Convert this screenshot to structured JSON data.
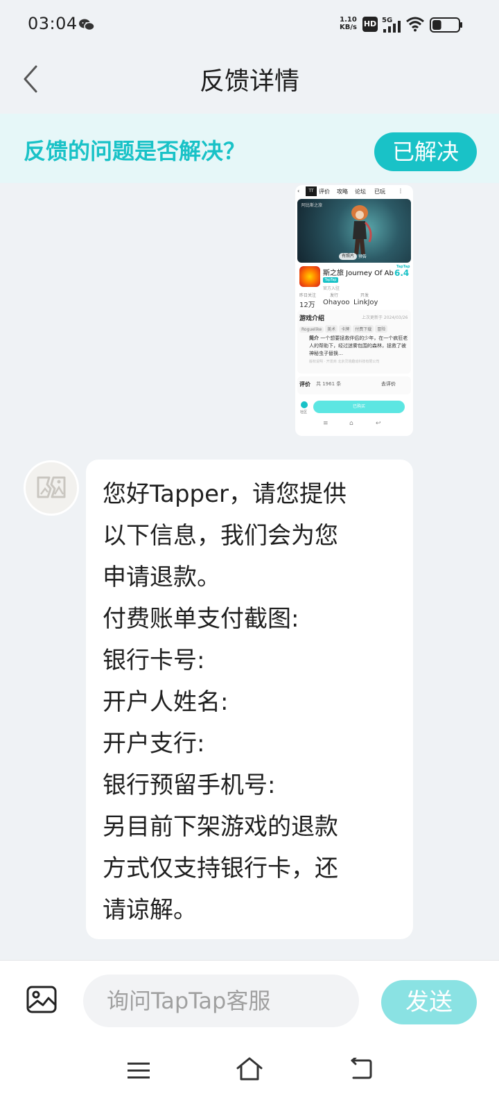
{
  "status_bar": {
    "time": "03:04",
    "net_speed_value": "1.10",
    "net_speed_unit": "KB/s",
    "hd_label": "HD",
    "signal_label": "5G",
    "battery_level": 0.35,
    "icons": [
      "wechat-icon",
      "hd-icon",
      "signal-icon",
      "wifi-icon",
      "battery-icon"
    ]
  },
  "header": {
    "title": "反馈详情",
    "back_icon": "chevron-left-icon"
  },
  "resolution_banner": {
    "question": "反馈的问题是否解决？",
    "resolved_label": "已解决"
  },
  "attachment": {
    "topbar": {
      "tab_reviews": "评价",
      "tab_guides": "攻略",
      "tab_forum": "论坛",
      "played": "已玩"
    },
    "banner_logo": "阿比斯之旅",
    "banner_chip_photos": "有照片",
    "banner_chip_video": "预告",
    "game_name": "斯之旅 Journey Of Ab",
    "badge": "TapTap",
    "official_tag": "官方入驻",
    "rating_tag": "TapTap",
    "rating": "6.4",
    "stats_labels": [
      "昨日关注",
      "发行",
      "开发"
    ],
    "stats_values": [
      "12万",
      "Ohayoo",
      "LinkJoy"
    ],
    "intro_title": "游戏介绍",
    "intro_date": "上次更新于 2024/03/26",
    "tags": [
      "Roguelike",
      "美术",
      "卡牌",
      "付费下载",
      "冒险"
    ],
    "intro_text_label": "简介",
    "intro_text": "一个想要拯救伴侣的少年，在一个疯狂老人的帮助下，经过迷雾包围的森林，拯救了被神秘虫子替换…",
    "intro_footer": "版权说明 · 开发商 北京灵境趣动科技有限公司",
    "review_title": "评价",
    "review_count": "共 1961 条",
    "review_link": "去评价",
    "bottom_label": "社区",
    "bottom_button": "已购买",
    "navbar": [
      "≡",
      "⌂",
      "↩"
    ]
  },
  "message": {
    "avatar_icon": "broken-image-icon",
    "lines": [
      "您好Tapper，请您提供",
      "以下信息，我们会为您",
      "申请退款。",
      "付费账单支付截图:",
      "银行卡号:",
      "开户人姓名:",
      "开户支行:",
      "银行预留手机号:",
      "另目前下架游戏的退款",
      "方式仅支持银行卡，还",
      "请谅解。"
    ]
  },
  "composer": {
    "image_icon": "image-icon",
    "placeholder": "询问TapTap客服",
    "send_label": "发送"
  },
  "nav_bar": {
    "icons": [
      "menu-icon",
      "home-icon",
      "back-icon"
    ]
  },
  "colors": {
    "accent": "#19c2c7",
    "accent_light": "#8ae2e3",
    "banner_bg": "#e6f7f8",
    "page_bg": "#eff2f5"
  }
}
